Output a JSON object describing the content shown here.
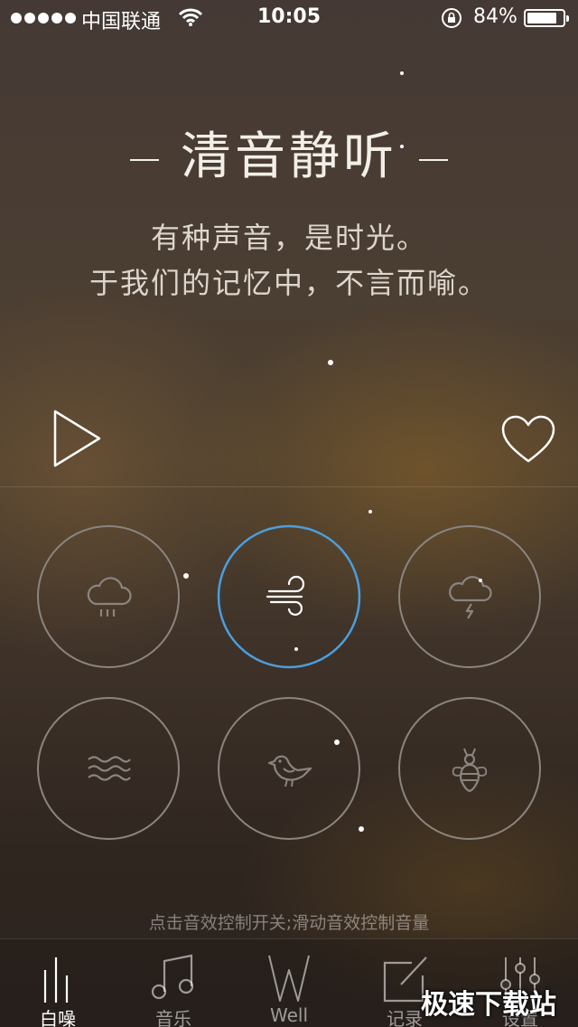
{
  "status_bar": {
    "carrier": "中国联通",
    "time": "10:05",
    "battery_percent": "84%",
    "battery_level": 0.84,
    "icons": [
      "signal-dots-icon",
      "wifi-icon",
      "rotation-lock-icon",
      "battery-icon"
    ]
  },
  "header": {
    "title": "清音静听",
    "line1": "有种声音，是时光。",
    "line2": "于我们的记忆中，不言而喻。"
  },
  "controls": {
    "play_icon": "play-icon",
    "favorite_icon": "heart-icon"
  },
  "sounds": [
    {
      "id": "rain",
      "icon": "rain-cloud-icon",
      "active": false
    },
    {
      "id": "wind",
      "icon": "wind-icon",
      "active": true
    },
    {
      "id": "thunder",
      "icon": "thunder-cloud-icon",
      "active": false
    },
    {
      "id": "waves",
      "icon": "waves-icon",
      "active": false
    },
    {
      "id": "bird",
      "icon": "bird-icon",
      "active": false
    },
    {
      "id": "insect",
      "icon": "bee-icon",
      "active": false
    }
  ],
  "colors": {
    "accent": "#4a9fe0",
    "ring": "#8a8580"
  },
  "hint": "点击音效控制开关;滑动音效控制音量",
  "tabs": [
    {
      "label": "白噪",
      "icon": "bars-icon",
      "active": true
    },
    {
      "label": "音乐",
      "icon": "music-note-icon",
      "active": false
    },
    {
      "label": "Well",
      "icon": "w-logo-icon",
      "active": false
    },
    {
      "label": "记录",
      "icon": "edit-icon",
      "active": false
    },
    {
      "label": "设置",
      "icon": "sliders-icon",
      "active": false
    }
  ],
  "watermark": "极速下载站"
}
